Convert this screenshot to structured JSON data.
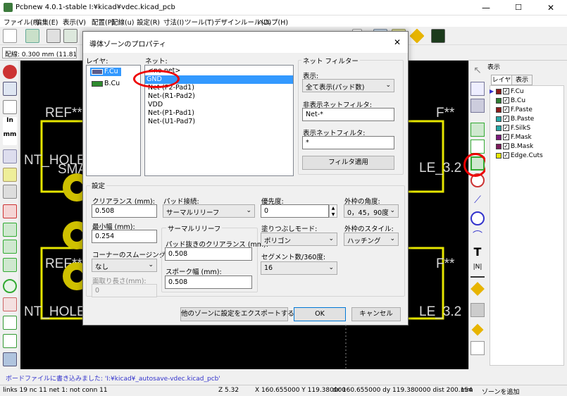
{
  "window": {
    "title": "Pcbnew 4.0.1-stable I:¥kicad¥vdec.kicad_pcb",
    "minimize": "—",
    "maximize": "☐",
    "close": "✕"
  },
  "menu": [
    "ファイル(F)",
    "編集(E)",
    "表示(V)",
    "配置(P)",
    "配線(u)",
    "設定(R)",
    "寸法(I)",
    "ツール(T)",
    "デザインルール(D)",
    "ヘルプ(H)"
  ],
  "toolbar2": {
    "track_width": "配線: 0.300 mm (11.81 mils)"
  },
  "canvas": {
    "ref_left_top": "REF**",
    "ref_right_top": "F**",
    "nt_hole_left_top": "NT_HOLE",
    "nt_hole_right_top": "LE_3.2",
    "sma": "SMA",
    "ref_left_bottom": "REF**",
    "ref_right_bottom": "F**",
    "nt_hole_left_bottom": "NT_HOLE",
    "nt_hole_right_bottom": "LE_3.2"
  },
  "panel": {
    "title": "表示",
    "tabs": [
      "レイヤ",
      "表示"
    ],
    "layers": [
      {
        "name": "F.Cu",
        "color": "#8b1a1a",
        "active": true
      },
      {
        "name": "B.Cu",
        "color": "#2e7d32",
        "active": false
      },
      {
        "name": "F.Paste",
        "color": "#8b1a1a",
        "active": false
      },
      {
        "name": "B.Paste",
        "color": "#26a6a6",
        "active": false
      },
      {
        "name": "F.SilkS",
        "color": "#26a6a6",
        "active": false
      },
      {
        "name": "F.Mask",
        "color": "#7b1a7b",
        "active": false
      },
      {
        "name": "B.Mask",
        "color": "#7b1a5a",
        "active": false
      },
      {
        "name": "Edge.Cuts",
        "color": "#e5e500",
        "active": false
      }
    ]
  },
  "message": "ボードファイルに書き込みました: 'I:¥kicad¥_autosave-vdec.kicad_pcb'",
  "status": {
    "links": "links 19 nc 11  net 1: not conn 11",
    "zoom": "Z 5.32",
    "xy": "X 160.655000  Y 119.380000",
    "dxy": "dx 160.655000  dy 119.380000  dist 200.154",
    "unit": "mm",
    "mode": "ゾーンを追加"
  },
  "dialog": {
    "title": "導体ゾーンのプロパティ",
    "close": "✕",
    "layer_label": "レイヤ:",
    "layers": [
      {
        "name": "F.Cu",
        "color": "#5c5c8a",
        "selected": true
      },
      {
        "name": "B.Cu",
        "color": "#2e8b2e",
        "selected": false
      }
    ],
    "net_label": "ネット:",
    "nets": [
      "<no net>",
      "GND",
      "Net-(P2-Pad1)",
      "Net-(R1-Pad2)",
      "VDD",
      "Net-(P1-Pad1)",
      "Net-(U1-Pad7)"
    ],
    "selected_net": "GND",
    "filter": {
      "group": "ネット フィルター",
      "display_label": "表示:",
      "display_value": "全て表示(パッド数)",
      "hidden_label": "非表示ネットフィルタ:",
      "hidden_value": "Net-*",
      "shown_label": "表示ネットフィルタ:",
      "shown_value": "*",
      "apply": "フィルタ適用"
    },
    "settings": {
      "group": "設定",
      "clearance_label": "クリアランス (mm):",
      "clearance": "0.508",
      "min_width_label": "最小幅 (mm):",
      "min_width": "0.254",
      "corner_label": "コーナーのスムージング",
      "corner": "なし",
      "chamfer_label": "面取り長さ(mm):",
      "chamfer": "0",
      "pad_conn_label": "パッド接続:",
      "pad_conn": "サーマルリリーフ",
      "thermal_group": "サーマルリリーフ",
      "antipad_label": "パッド抜きのクリアランス (mm):",
      "antipad": "0.508",
      "spoke_label": "スポーク幅 (mm):",
      "spoke": "0.508",
      "priority_label": "優先度:",
      "priority": "0",
      "fill_mode_label": "塗りつぶしモード:",
      "fill_mode": "ポリゴン",
      "segments_label": "セグメント数/360度:",
      "segments": "16",
      "outline_angle_label": "外枠の角度:",
      "outline_angle": "0，45，90度",
      "outline_style_label": "外枠のスタイル:",
      "outline_style": "ハッチング"
    },
    "export": "他のゾーンに設定をエクスポートする",
    "ok": "OK",
    "cancel": "キャンセル"
  }
}
